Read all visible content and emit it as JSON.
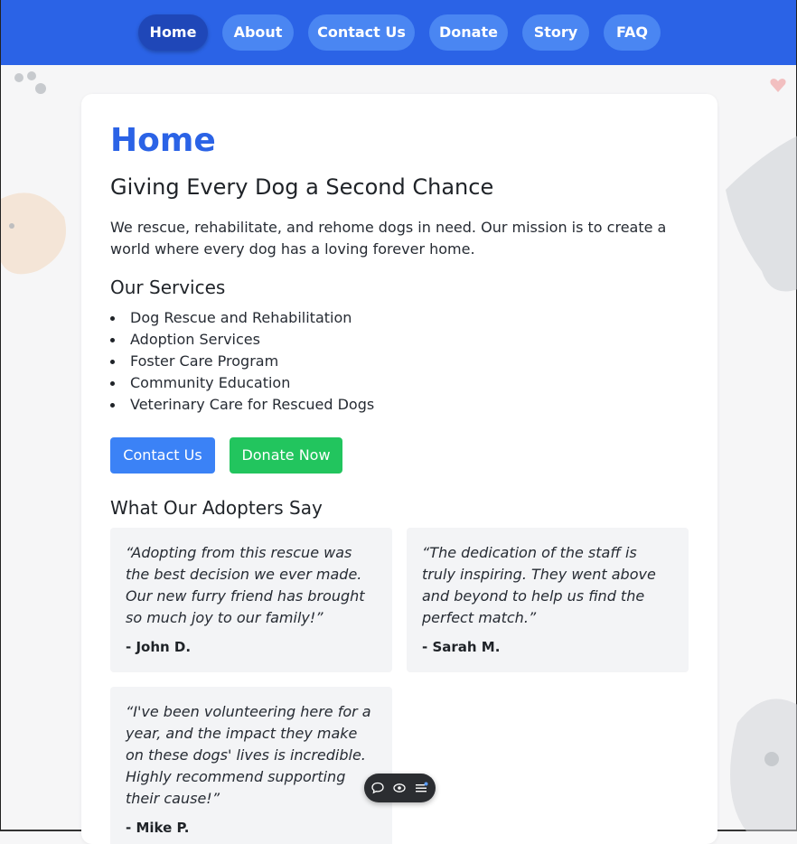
{
  "nav": {
    "items": [
      {
        "label": "Home",
        "active": true
      },
      {
        "label": "About",
        "active": false
      },
      {
        "label": "Contact Us",
        "active": false
      },
      {
        "label": "Donate",
        "active": false
      },
      {
        "label": "Story",
        "active": false
      },
      {
        "label": "FAQ",
        "active": false
      }
    ]
  },
  "main": {
    "title": "Home",
    "subtitle": "Giving Every Dog a Second Chance",
    "mission": "We rescue, rehabilitate, and rehome dogs in need. Our mission is to create a world where every dog has a loving forever home.",
    "services": {
      "heading": "Our Services",
      "items": [
        "Dog Rescue and Rehabilitation",
        "Adoption Services",
        "Foster Care Program",
        "Community Education",
        "Veterinary Care for Rescued Dogs"
      ]
    },
    "buttons": {
      "contact_label": "Contact Us",
      "donate_label": "Donate Now"
    },
    "testimonials": {
      "heading": "What Our Adopters Say",
      "items": [
        {
          "quote": "“Adopting from this rescue was the best decision we ever made. Our new furry friend has brought so much joy to our family!”",
          "author": "- John D."
        },
        {
          "quote": "“The dedication of the staff is truly inspiring. They went above and beyond to help us find the perfect match.”",
          "author": "- Sarah M."
        },
        {
          "quote": "“I've been volunteering here for a year, and the impact they make on these dogs' lives is incredible. Highly recommend supporting their cause!”",
          "author": "- Mike P."
        }
      ]
    }
  },
  "toolbar": {
    "icons": [
      "comment-icon",
      "eye-icon",
      "list-icon"
    ]
  },
  "colors": {
    "nav_bg": "#2b63e6",
    "nav_pill": "#4a86f2",
    "nav_pill_active": "#1f47b8",
    "title": "#2b63e6",
    "contact_button": "#3b82f6",
    "donate_button": "#22c55e",
    "testimonial_bg": "#f3f4f6"
  }
}
